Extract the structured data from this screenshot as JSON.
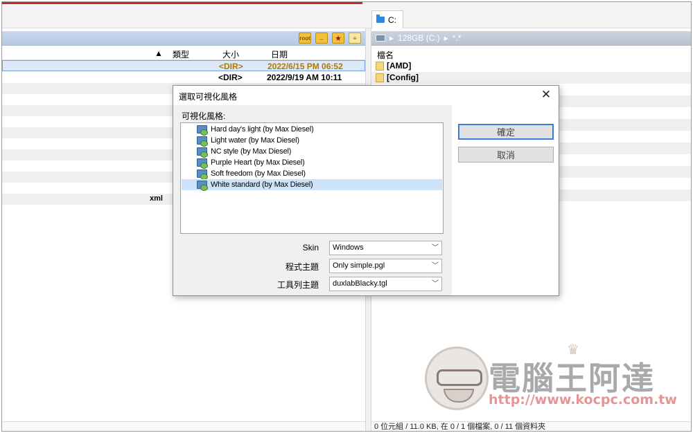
{
  "left_panel": {
    "header": {
      "sort_arrow": "▲",
      "type": "類型",
      "size": "大小",
      "date": "日期"
    },
    "rows": [
      {
        "size": "<DIR>",
        "date": "2022/6/15 PM 06:52"
      },
      {
        "size": "<DIR>",
        "date": "2022/9/19 AM 10:11"
      }
    ],
    "ext_row": "xml",
    "toolbar_icons": [
      "root-folder-icon",
      "up-folder-icon",
      "favorites-star-icon",
      "notes-icon"
    ]
  },
  "right_panel": {
    "tab_label": "C:",
    "path": "128GB (C:)",
    "path_sep": "▸",
    "path_filter": "*.*",
    "header_name": "檔名",
    "rows": [
      {
        "name": "[AMD]"
      },
      {
        "name": "[Config]"
      }
    ],
    "status": "0 位元組 / 11.0 KB, 在 0 / 1 個檔案, 0 / 11 個資料夾"
  },
  "dialog": {
    "title": "選取可視化風格",
    "close_glyph": "✕",
    "list_label": "可視化風格:",
    "styles": [
      {
        "label": "Hard day's light (by Max Diesel)",
        "selected": false
      },
      {
        "label": "Light water (by Max Diesel)",
        "selected": false
      },
      {
        "label": "NC style (by Max Diesel)",
        "selected": false
      },
      {
        "label": "Purple Heart (by Max Diesel)",
        "selected": false
      },
      {
        "label": "Soft freedom (by Max Diesel)",
        "selected": false
      },
      {
        "label": "White standard (by Max Diesel)",
        "selected": true
      }
    ],
    "skin_label": "Skin",
    "skin_value": "Windows",
    "program_theme_label": "程式主題",
    "program_theme_value": "Only simple.pgl",
    "toolbar_theme_label": "工具列主題",
    "toolbar_theme_value": "duxlabBlacky.tgl",
    "ok_label": "確定",
    "cancel_label": "取消"
  },
  "watermark": {
    "title": "電腦王阿達",
    "url": "http://www.kocpc.com.tw"
  },
  "colors": {
    "selection_row": "#dce9fa",
    "dir_selected_text": "#b07a00",
    "path_bar_left": "#b6c9e6",
    "path_bar_right": "#b9c3d2",
    "default_button_border": "#3a7bd5",
    "list_selection": "#cde3f7"
  }
}
